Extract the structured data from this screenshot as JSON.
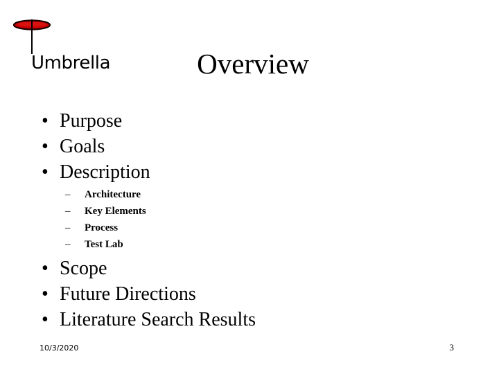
{
  "slide": {
    "title": "Overview",
    "background_color": "#ffffff",
    "text_color": "#000000"
  },
  "logo": {
    "name": "umbrella-logo",
    "label": "Umbrella",
    "canopy_color": "#cc0000",
    "canopy_outline_color": "#1a0000",
    "pole_color": "#000000"
  },
  "body": {
    "bullet_marker": "•",
    "sub_bullet_marker": "–",
    "items": [
      {
        "label": "Purpose",
        "level": 1
      },
      {
        "label": "Goals",
        "level": 1
      },
      {
        "label": "Description",
        "level": 1
      },
      {
        "label": "Scope",
        "level": 1
      },
      {
        "label": "Future Directions",
        "level": 1
      },
      {
        "label": "Literature Search Results",
        "level": 1
      }
    ],
    "sub_items": [
      {
        "label": "Architecture",
        "level": 2
      },
      {
        "label": "Key Elements",
        "level": 2
      },
      {
        "label": "Process",
        "level": 2
      },
      {
        "label": "Test Lab",
        "level": 2
      }
    ]
  },
  "footer": {
    "date": "10/3/2020",
    "page_number": "3"
  }
}
